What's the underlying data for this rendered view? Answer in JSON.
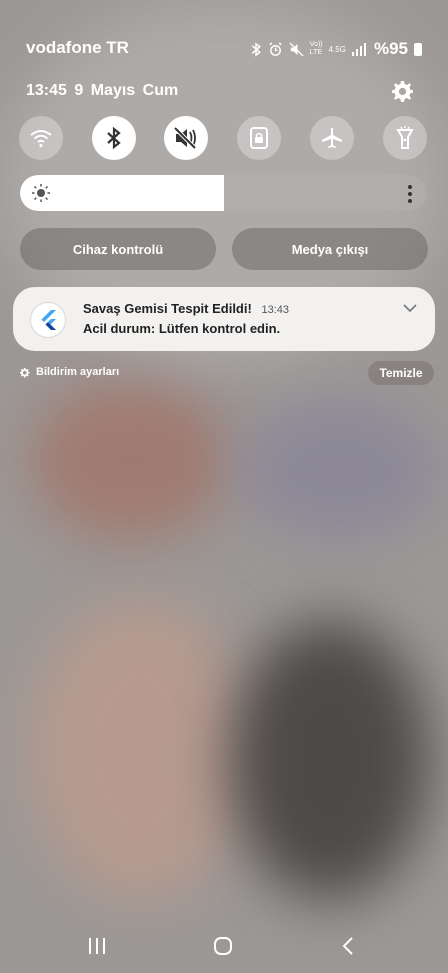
{
  "status_bar": {
    "carrier": "vodafone TR",
    "network_top": "Vo))",
    "network_bottom": "LTE",
    "network_type": "4.5G",
    "battery_text": "%95",
    "icons": [
      "bluetooth-icon",
      "alarm-icon",
      "mute-icon",
      "signal-icon",
      "battery-icon"
    ]
  },
  "header": {
    "time": "13:45",
    "date": "9 Mayıs Cum"
  },
  "quick_settings": [
    {
      "name": "wifi",
      "state": "off"
    },
    {
      "name": "bluetooth",
      "state": "on"
    },
    {
      "name": "sound-mute",
      "state": "on"
    },
    {
      "name": "screen-lock",
      "state": "off"
    },
    {
      "name": "airplane",
      "state": "off"
    },
    {
      "name": "flashlight",
      "state": "off"
    }
  ],
  "brightness": {
    "level_percent": 50
  },
  "panels": {
    "device_control": "Cihaz kontrolü",
    "media_output": "Medya çıkışı"
  },
  "notification": {
    "app_icon": "flutter-icon",
    "title": "Savaş Gemisi Tespit Edildi!",
    "time": "13:43",
    "body": "Acil durum: Lütfen kontrol edin."
  },
  "footer": {
    "settings_label": "Bildirim ayarları",
    "clear_label": "Temizle"
  },
  "colors": {
    "accent_white": "#ffffff",
    "flutter_blue": "#42a5f5",
    "flutter_dark": "#0d47a1"
  }
}
